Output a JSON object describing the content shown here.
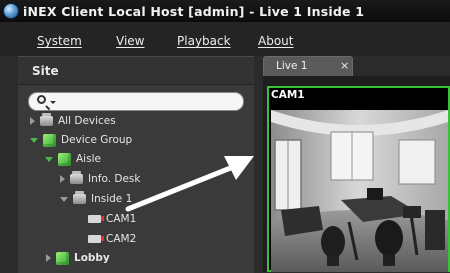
{
  "window": {
    "title": "iNEX Client Local Host [admin] - Live  1  Inside 1"
  },
  "menu": {
    "items": [
      {
        "label": "System"
      },
      {
        "label": "View"
      },
      {
        "label": "Playback"
      },
      {
        "label": "About"
      }
    ]
  },
  "sidebar": {
    "header": "Site",
    "search": {
      "placeholder": ""
    },
    "tree": [
      {
        "label": "All Devices",
        "icon": "device-icon",
        "expanded": false
      },
      {
        "label": "Device Group",
        "icon": "group-icon",
        "expanded": true
      },
      {
        "label": "Aisle",
        "icon": "group-icon",
        "expanded": true
      },
      {
        "label": "Info. Desk",
        "icon": "device-icon",
        "expanded": false
      },
      {
        "label": "Inside 1",
        "icon": "device-icon",
        "expanded": true
      },
      {
        "label": "CAM1",
        "icon": "camera-icon"
      },
      {
        "label": "CAM2",
        "icon": "camera-icon"
      },
      {
        "label": "Lobby",
        "icon": "group-icon",
        "expanded": false
      }
    ]
  },
  "tabs": [
    {
      "label": "Live  1",
      "close": "×"
    }
  ],
  "view": {
    "camera_label": "CAM1"
  },
  "colors": {
    "active_border": "#39c239",
    "group_green": "#4cb84c"
  }
}
